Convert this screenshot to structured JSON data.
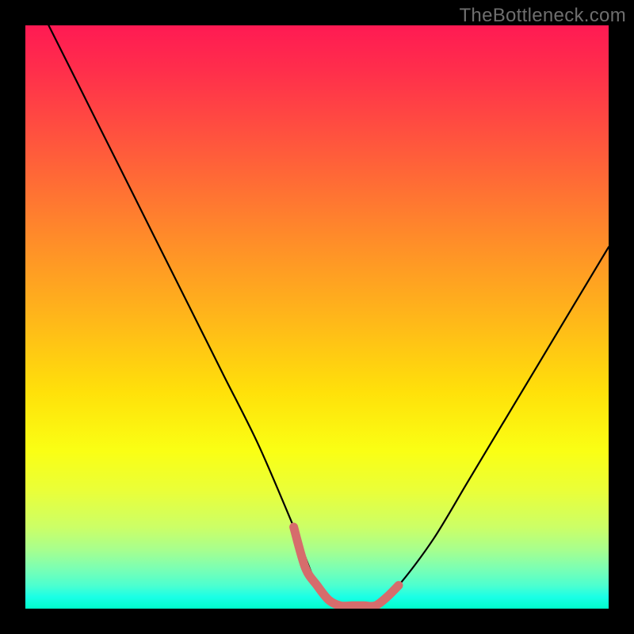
{
  "watermark": "TheBottleneck.com",
  "chart_data": {
    "type": "line",
    "title": "",
    "xlabel": "",
    "ylabel": "",
    "xlim": [
      0,
      100
    ],
    "ylim": [
      0,
      100
    ],
    "series": [
      {
        "name": "bottleneck-curve",
        "x": [
          4,
          10,
          16,
          22,
          28,
          34,
          40,
          46,
          50,
          53,
          56,
          60,
          64,
          70,
          76,
          82,
          88,
          94,
          100
        ],
        "y": [
          100,
          88,
          76,
          64,
          52,
          40,
          28,
          14,
          4,
          0.5,
          0.5,
          0.5,
          4,
          12,
          22,
          32,
          42,
          52,
          62
        ]
      }
    ],
    "highlight": {
      "name": "trough-segment",
      "color": "#d66c6c",
      "x": [
        46,
        48,
        50,
        52,
        54,
        56,
        58,
        60,
        62,
        64
      ],
      "y": [
        14,
        7,
        4,
        1.5,
        0.5,
        0.5,
        0.5,
        0.5,
        2,
        4
      ]
    },
    "gradient_stops": [
      {
        "pos": 0,
        "color": "#ff1a53"
      },
      {
        "pos": 50,
        "color": "#ffb61a"
      },
      {
        "pos": 80,
        "color": "#e9ff3a"
      },
      {
        "pos": 100,
        "color": "#00ffcc"
      }
    ]
  }
}
